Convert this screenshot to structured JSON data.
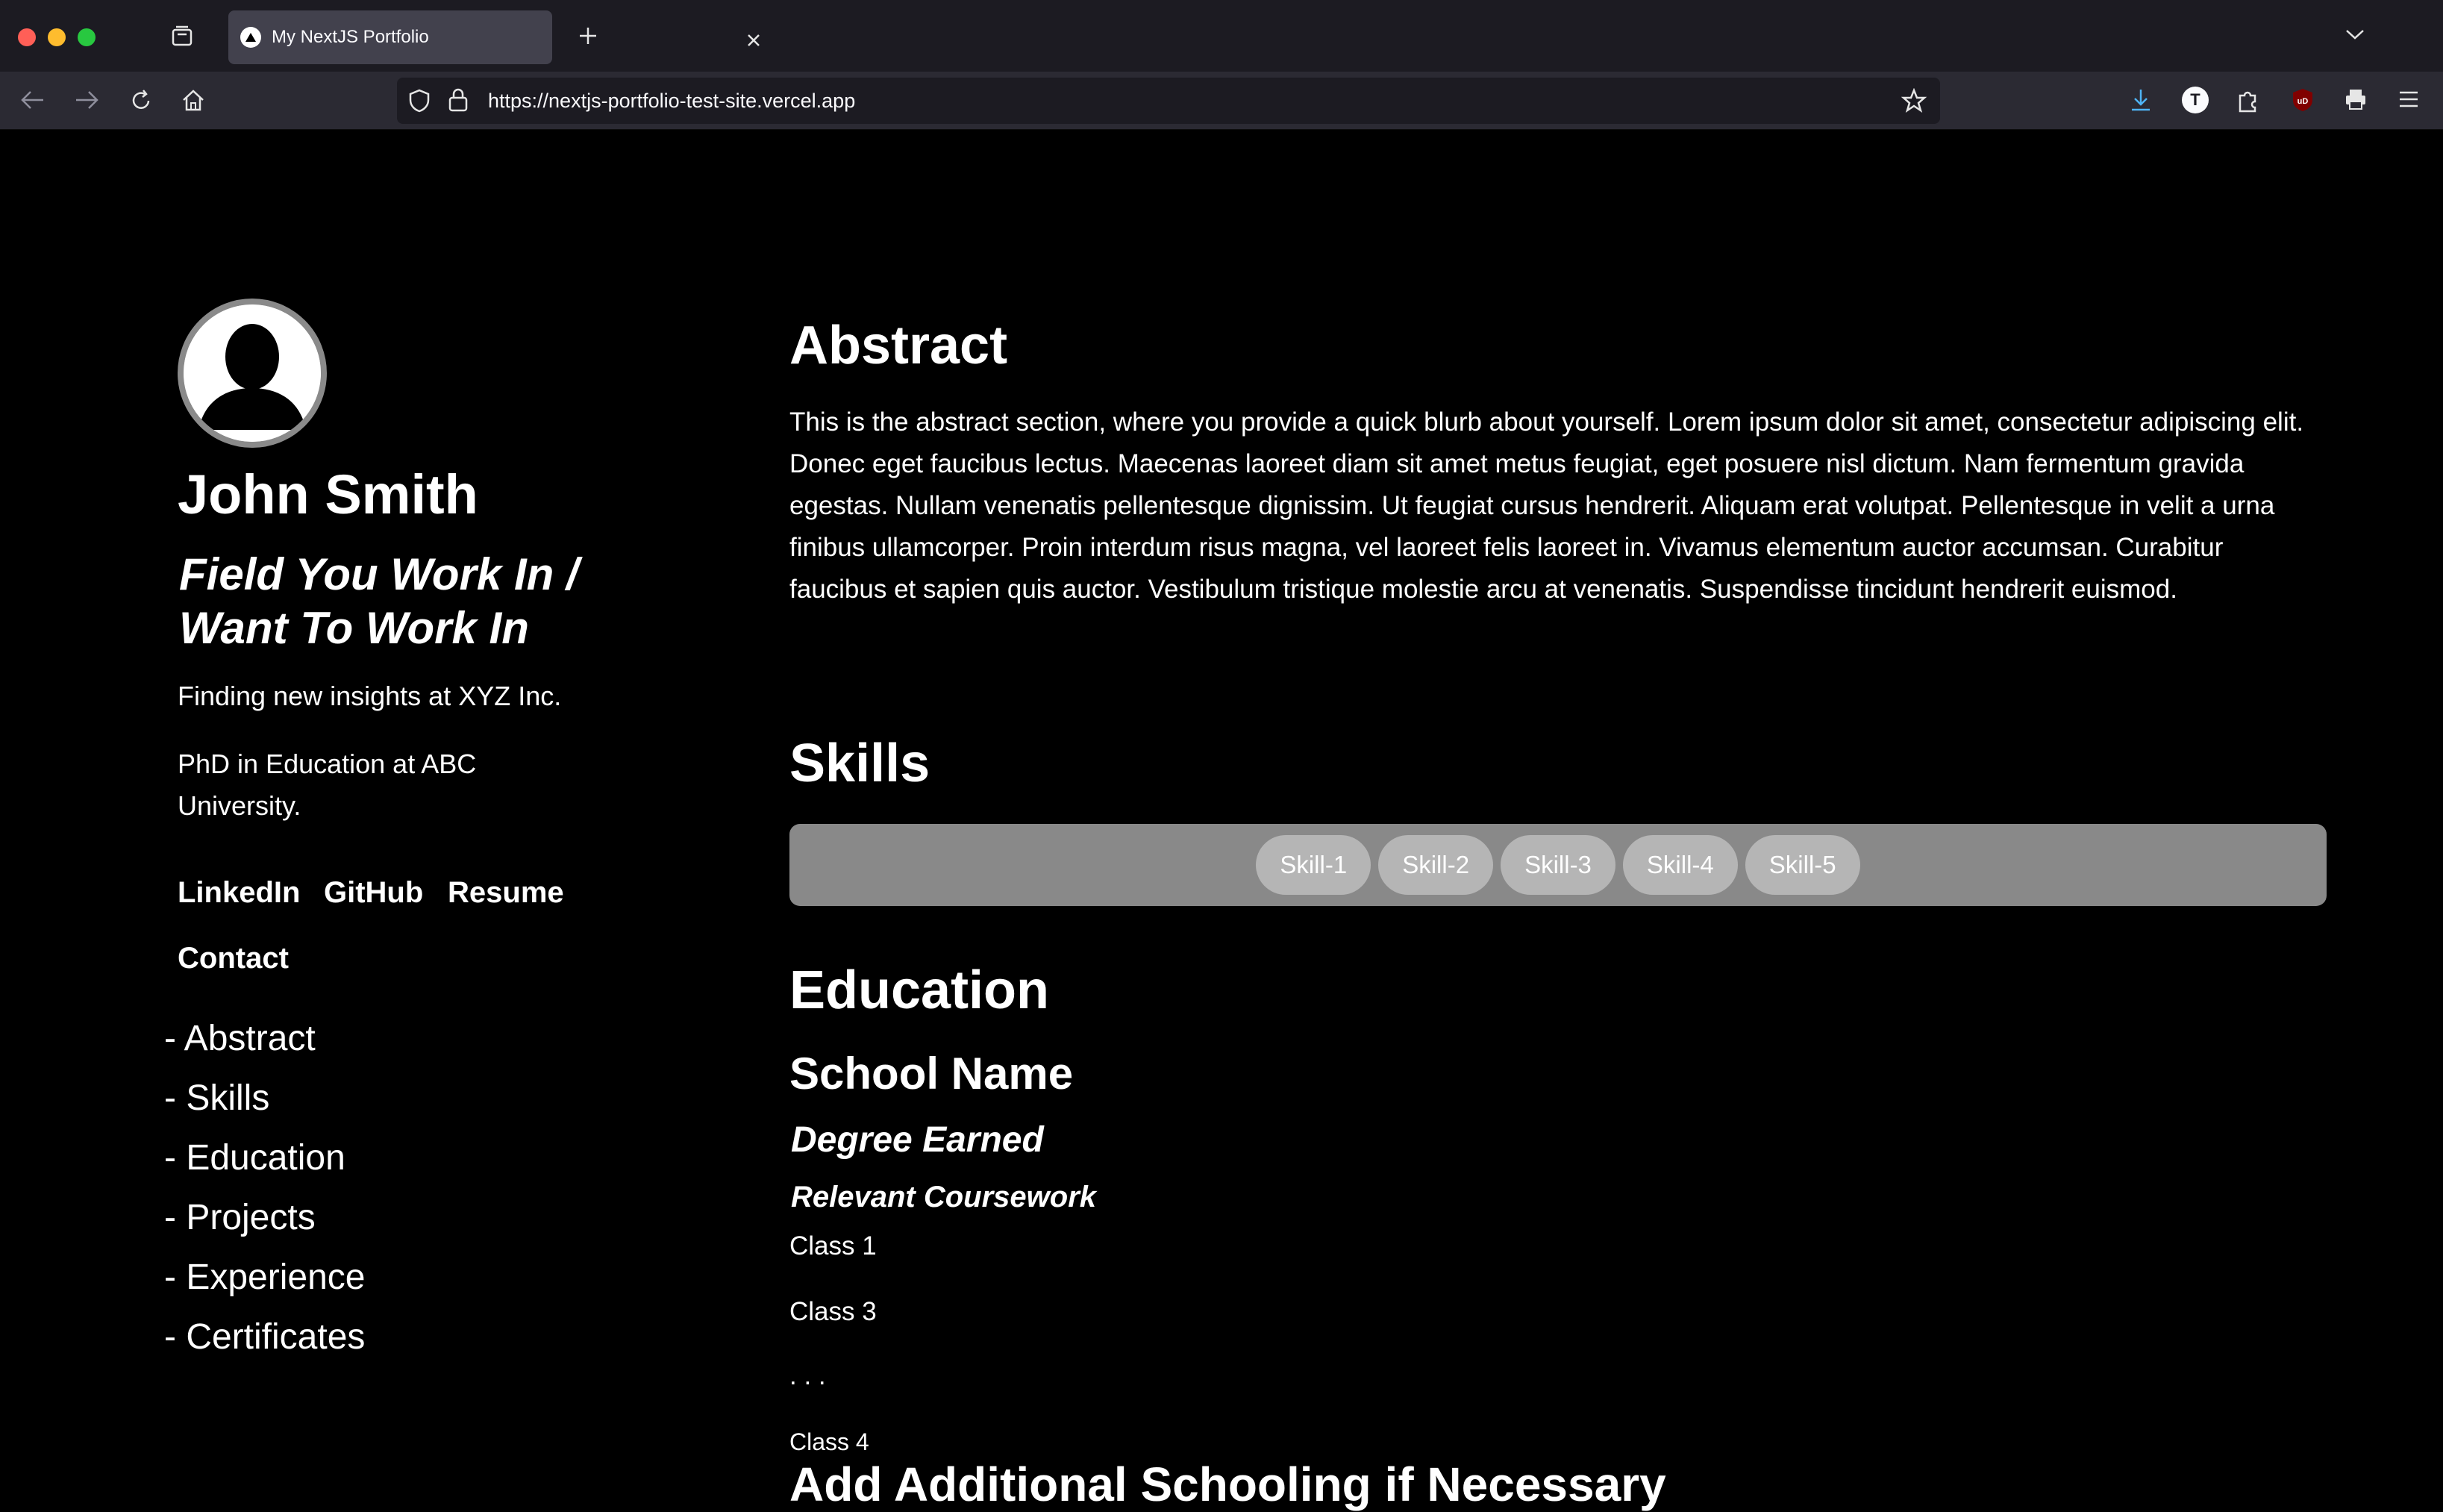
{
  "browser": {
    "tab_title": "My NextJS Portfolio",
    "url": "https://nextjs-portfolio-test-site.vercel.app",
    "profile_initial": "T",
    "ublock_label": "uD"
  },
  "profile": {
    "name": "John Smith",
    "field": "Field You Work In / Want To Work In",
    "current": "Finding new insights at XYZ Inc.",
    "education": "PhD in Education at ABC University."
  },
  "links": [
    "LinkedIn",
    "GitHub",
    "Resume",
    "Contact"
  ],
  "toc": [
    "- Abstract",
    "- Skills",
    "- Education",
    "- Projects",
    "- Experience",
    "- Certificates"
  ],
  "abstract": {
    "heading": "Abstract",
    "text": "This is the abstract section, where you provide a quick blurb about yourself. Lorem ipsum dolor sit amet, consectetur adipiscing elit. Donec eget faucibus lectus. Maecenas laoreet diam sit amet metus feugiat, eget posuere nisl dictum. Nam fermentum gravida egestas. Nullam venenatis pellentesque dignissim. Ut feugiat cursus hendrerit. Aliquam erat volutpat. Pellentesque in velit a urna finibus ullamcorper. Proin interdum risus magna, vel laoreet felis laoreet in. Vivamus elementum auctor accumsan. Curabitur faucibus et sapien quis auctor. Vestibulum tristique molestie arcu at venenatis. Suspendisse tincidunt hendrerit euismod."
  },
  "skills": {
    "heading": "Skills",
    "items": [
      "Skill-1",
      "Skill-2",
      "Skill-3",
      "Skill-4",
      "Skill-5"
    ]
  },
  "education": {
    "heading": "Education",
    "school": "School Name",
    "degree": "Degree Earned",
    "coursework_heading": "Relevant Coursework",
    "classes": [
      "Class 1",
      "Class 3",
      ". . .",
      "Class 4"
    ],
    "additional": "Add Additional Schooling if Necessary"
  },
  "colors": {
    "background": "#000000",
    "text": "#ffffff",
    "skills_box": "#898989",
    "skill_pill": "#b5b5b5"
  }
}
